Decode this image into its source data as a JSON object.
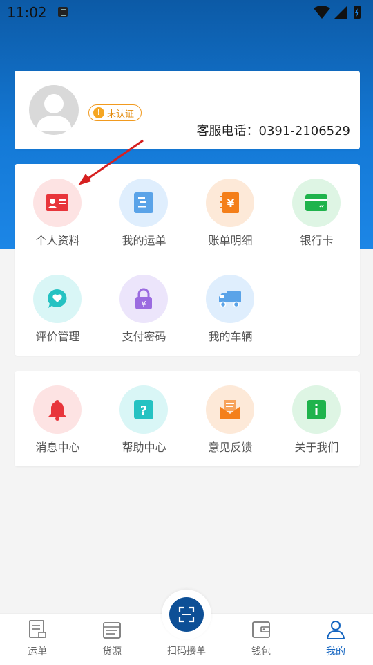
{
  "status_bar": {
    "time": "11:02"
  },
  "profile": {
    "badge": "未认证",
    "service_phone": "客服电话：0391-2106529"
  },
  "section1": {
    "items": [
      {
        "label": "个人资料",
        "icon": "id-card-icon"
      },
      {
        "label": "我的运单",
        "icon": "document-icon"
      },
      {
        "label": "账单明细",
        "icon": "bill-icon"
      },
      {
        "label": "银行卡",
        "icon": "bank-card-icon"
      },
      {
        "label": "评价管理",
        "icon": "chat-heart-icon"
      },
      {
        "label": "支付密码",
        "icon": "lock-icon"
      },
      {
        "label": "我的车辆",
        "icon": "truck-icon"
      }
    ]
  },
  "section2": {
    "items": [
      {
        "label": "消息中心",
        "icon": "bell-icon"
      },
      {
        "label": "帮助中心",
        "icon": "question-icon"
      },
      {
        "label": "意见反馈",
        "icon": "envelope-icon"
      },
      {
        "label": "关于我们",
        "icon": "info-icon"
      }
    ]
  },
  "tabbar": {
    "items": [
      {
        "label": "运单"
      },
      {
        "label": "货源"
      },
      {
        "label": "扫码接单"
      },
      {
        "label": "钱包"
      },
      {
        "label": "我的"
      }
    ]
  },
  "colors": {
    "header_blue": "#1479d6",
    "accent_orange": "#f19a1f",
    "active_tab": "#1565c0"
  }
}
